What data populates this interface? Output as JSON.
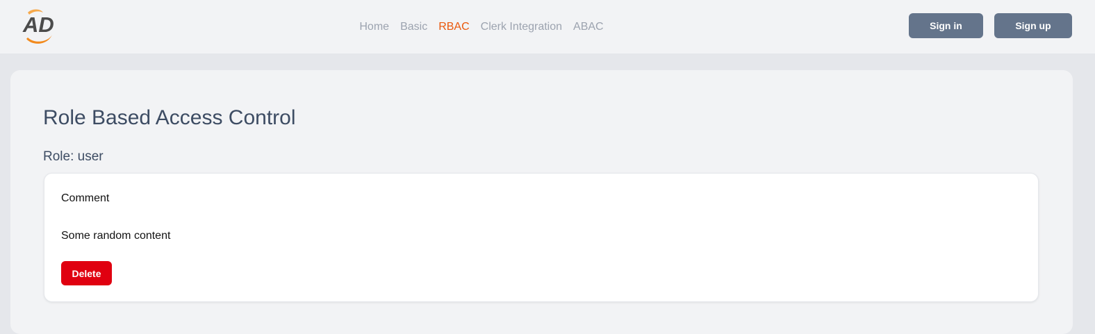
{
  "header": {
    "logo_text": "AD",
    "nav": [
      {
        "label": "Home",
        "active": false
      },
      {
        "label": "Basic",
        "active": false
      },
      {
        "label": "RBAC",
        "active": true
      },
      {
        "label": "Clerk Integration",
        "active": false
      },
      {
        "label": "ABAC",
        "active": false
      }
    ],
    "signin_label": "Sign in",
    "signup_label": "Sign up"
  },
  "main": {
    "title": "Role Based Access Control",
    "role_line": "Role: user",
    "comment": {
      "title": "Comment",
      "body": "Some random content",
      "delete_label": "Delete"
    }
  },
  "colors": {
    "accent": "#ea580c",
    "button": "#64748b",
    "danger": "#e00010",
    "heading": "#3d4c63"
  }
}
